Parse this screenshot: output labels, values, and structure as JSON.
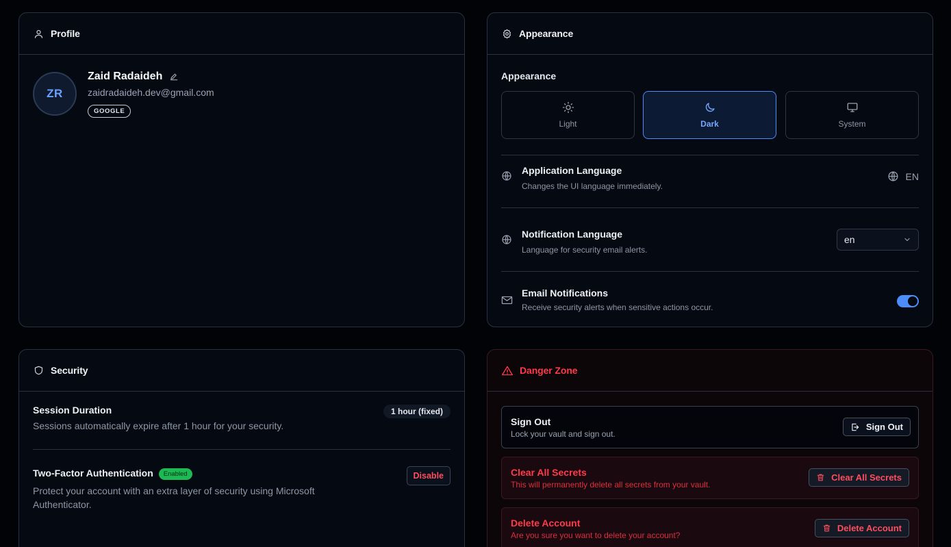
{
  "profile": {
    "header_title": "Profile",
    "initials": "ZR",
    "name": "Zaid Radaideh",
    "email": "zaidradaideh.dev@gmail.com",
    "provider": "GOOGLE"
  },
  "appearance": {
    "header_title": "Appearance",
    "section_label": "Appearance",
    "themes": [
      {
        "label": "Light",
        "icon": "sun-icon",
        "selected": false
      },
      {
        "label": "Dark",
        "icon": "moon-icon",
        "selected": true
      },
      {
        "label": "System",
        "icon": "monitor-icon",
        "selected": false
      }
    ],
    "app_language": {
      "title": "Application Language",
      "description": "Changes the UI language immediately.",
      "value": "EN"
    },
    "notification_language": {
      "title": "Notification Language",
      "description": "Language for security email alerts.",
      "value": "en"
    },
    "email_notifications": {
      "title": "Email Notifications",
      "description": "Receive security alerts when sensitive actions occur.",
      "enabled": true
    }
  },
  "security": {
    "header_title": "Security",
    "session": {
      "title": "Session Duration",
      "description": "Sessions automatically expire after 1 hour for your security.",
      "badge": "1 hour (fixed)"
    },
    "two_factor": {
      "title": "Two-Factor Authentication",
      "status": "Enabled",
      "description": "Protect your account with an extra layer of security using Microsoft Authenticator.",
      "action_label": "Disable"
    }
  },
  "danger": {
    "header_title": "Danger Zone",
    "sign_out": {
      "title": "Sign Out",
      "description": "Lock your vault and sign out.",
      "button": "Sign Out"
    },
    "clear_secrets": {
      "title": "Clear All Secrets",
      "description": "This will permanently delete all secrets from your vault.",
      "button": "Clear All Secrets"
    },
    "delete_account": {
      "title": "Delete Account",
      "description": "Are you sure you want to delete your account?",
      "button": "Delete Account"
    }
  },
  "colors": {
    "accent": "#4d8dfa",
    "danger": "#ff3b4a",
    "success": "#1db954",
    "background": "#020306",
    "card": "#050912"
  }
}
